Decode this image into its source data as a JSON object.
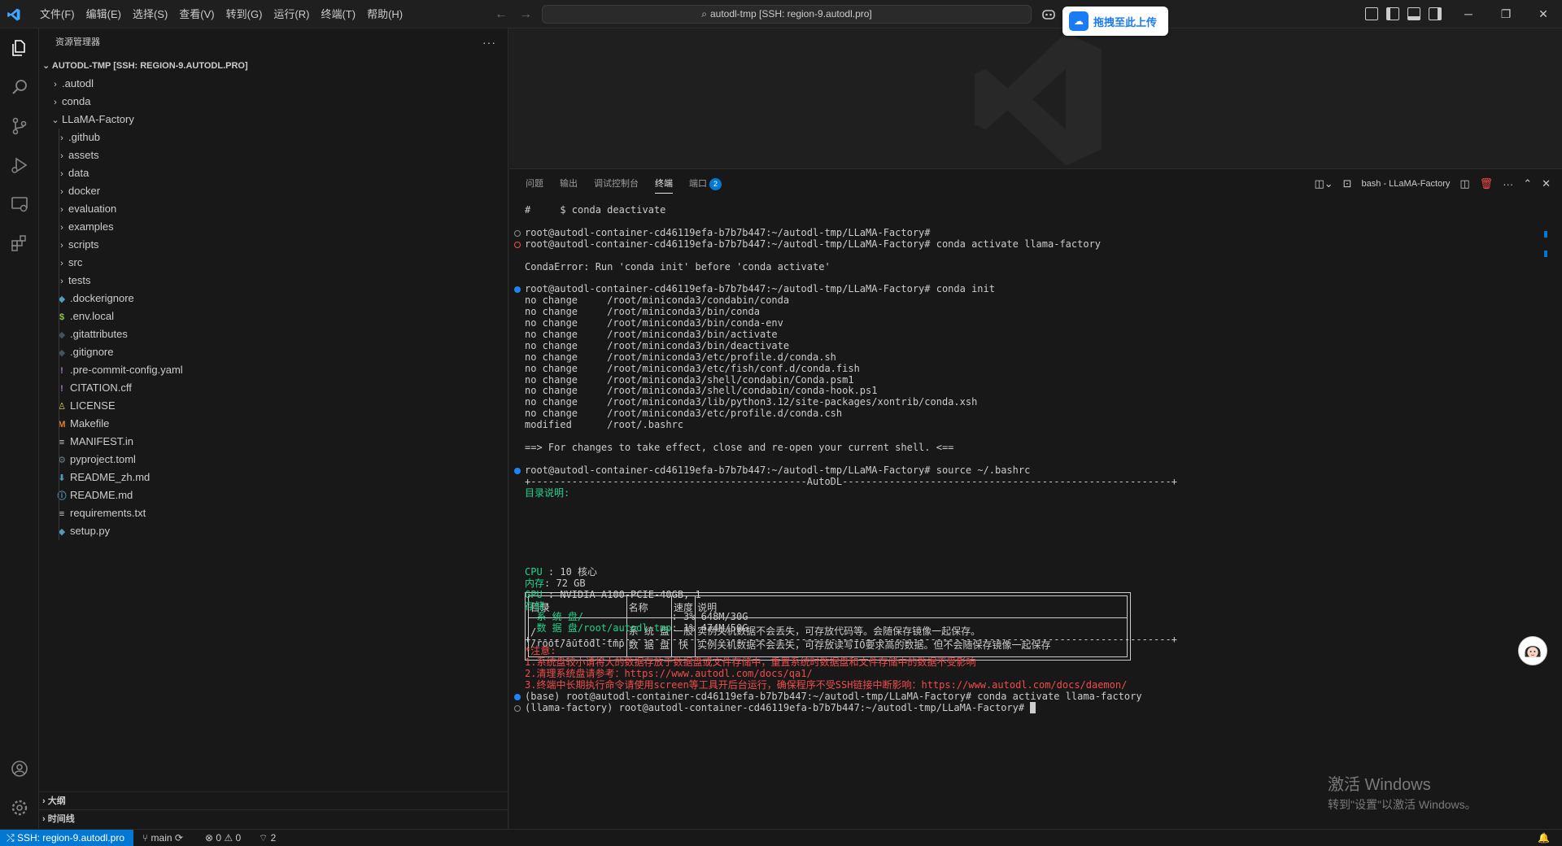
{
  "titlebar": {
    "menu": [
      "文件(F)",
      "编辑(E)",
      "选择(S)",
      "查看(V)",
      "转到(G)",
      "运行(R)",
      "终端(T)",
      "帮助(H)"
    ],
    "search": "autodl-tmp [SSH: region-9.autodl.pro]",
    "upload_label": "拖拽至此上传"
  },
  "sidebar": {
    "title": "资源管理器",
    "root": "AUTODL-TMP [SSH: REGION-9.AUTODL.PRO]",
    "items": [
      {
        "label": ".autodl",
        "type": "folder",
        "level": 0,
        "icon": "chevron-right"
      },
      {
        "label": "conda",
        "type": "folder",
        "level": 0,
        "icon": "chevron-right"
      },
      {
        "label": "LLaMA-Factory",
        "type": "folder",
        "level": 0,
        "icon": "chevron-down"
      },
      {
        "label": ".github",
        "type": "folder",
        "level": 1,
        "icon": "chevron-right"
      },
      {
        "label": "assets",
        "type": "folder",
        "level": 1,
        "icon": "chevron-right"
      },
      {
        "label": "data",
        "type": "folder",
        "level": 1,
        "icon": "chevron-right"
      },
      {
        "label": "docker",
        "type": "folder",
        "level": 1,
        "icon": "chevron-right"
      },
      {
        "label": "evaluation",
        "type": "folder",
        "level": 1,
        "icon": "chevron-right"
      },
      {
        "label": "examples",
        "type": "folder",
        "level": 1,
        "icon": "chevron-right"
      },
      {
        "label": "scripts",
        "type": "folder",
        "level": 1,
        "icon": "chevron-right"
      },
      {
        "label": "src",
        "type": "folder",
        "level": 1,
        "icon": "chevron-right"
      },
      {
        "label": "tests",
        "type": "folder",
        "level": 1,
        "icon": "chevron-right"
      },
      {
        "label": ".dockerignore",
        "type": "file",
        "level": 1,
        "glyph": "◆",
        "color": "#519aba"
      },
      {
        "label": ".env.local",
        "type": "file",
        "level": 1,
        "glyph": "$",
        "color": "#8dc149"
      },
      {
        "label": ".gitattributes",
        "type": "file",
        "level": 1,
        "glyph": "◆",
        "color": "#41535b"
      },
      {
        "label": ".gitignore",
        "type": "file",
        "level": 1,
        "glyph": "◆",
        "color": "#41535b"
      },
      {
        "label": ".pre-commit-config.yaml",
        "type": "file",
        "level": 1,
        "glyph": "!",
        "color": "#a074c4"
      },
      {
        "label": "CITATION.cff",
        "type": "file",
        "level": 1,
        "glyph": "!",
        "color": "#a074c4"
      },
      {
        "label": "LICENSE",
        "type": "file",
        "level": 1,
        "glyph": "♙",
        "color": "#cbcb41"
      },
      {
        "label": "Makefile",
        "type": "file",
        "level": 1,
        "glyph": "M",
        "color": "#e37933"
      },
      {
        "label": "MANIFEST.in",
        "type": "file",
        "level": 1,
        "glyph": "≡",
        "color": "#cccccc"
      },
      {
        "label": "pyproject.toml",
        "type": "file",
        "level": 1,
        "glyph": "⚙",
        "color": "#6d8086"
      },
      {
        "label": "README_zh.md",
        "type": "file",
        "level": 1,
        "glyph": "⬇",
        "color": "#519aba"
      },
      {
        "label": "README.md",
        "type": "file",
        "level": 1,
        "glyph": "ⓘ",
        "color": "#519aba"
      },
      {
        "label": "requirements.txt",
        "type": "file",
        "level": 1,
        "glyph": "≡",
        "color": "#cccccc"
      },
      {
        "label": "setup.py",
        "type": "file",
        "level": 1,
        "glyph": "◆",
        "color": "#519aba"
      }
    ],
    "outline": "大纲",
    "timeline": "时间线"
  },
  "panel": {
    "tabs": [
      "问题",
      "输出",
      "调试控制台",
      "终端",
      "端口"
    ],
    "active_tab": "终端",
    "ports_badge": "2",
    "terminal_name": "bash - LLaMA-Factory"
  },
  "terminal": {
    "lines": [
      {
        "text": "#     $ conda deactivate",
        "row": 0
      },
      {
        "text": "root@autodl-container-cd46119efa-b7b7b447:~/autodl-tmp/LLaMA-Factory#",
        "row": 2,
        "dot": "gray"
      },
      {
        "text": "root@autodl-container-cd46119efa-b7b7b447:~/autodl-tmp/LLaMA-Factory# conda activate llama-factory",
        "row": 3,
        "dot": "red"
      },
      {
        "text": "CondaError: Run 'conda init' before 'conda activate'",
        "row": 5
      },
      {
        "text": "root@autodl-container-cd46119efa-b7b7b447:~/autodl-tmp/LLaMA-Factory# conda init",
        "row": 7,
        "dot": "blue"
      },
      {
        "text": "no change     /root/miniconda3/condabin/conda",
        "row": 8
      },
      {
        "text": "no change     /root/miniconda3/bin/conda",
        "row": 9
      },
      {
        "text": "no change     /root/miniconda3/bin/conda-env",
        "row": 10
      },
      {
        "text": "no change     /root/miniconda3/bin/activate",
        "row": 11
      },
      {
        "text": "no change     /root/miniconda3/bin/deactivate",
        "row": 12
      },
      {
        "text": "no change     /root/miniconda3/etc/profile.d/conda.sh",
        "row": 13
      },
      {
        "text": "no change     /root/miniconda3/etc/fish/conf.d/conda.fish",
        "row": 14
      },
      {
        "text": "no change     /root/miniconda3/shell/condabin/Conda.psm1",
        "row": 15
      },
      {
        "text": "no change     /root/miniconda3/shell/condabin/conda-hook.ps1",
        "row": 16
      },
      {
        "text": "no change     /root/miniconda3/lib/python3.12/site-packages/xontrib/conda.xsh",
        "row": 17
      },
      {
        "text": "no change     /root/miniconda3/etc/profile.d/conda.csh",
        "row": 18
      },
      {
        "text": "modified      /root/.bashrc",
        "row": 19
      },
      {
        "text": "==> For changes to take effect, close and re-open your current shell. <==",
        "row": 21
      },
      {
        "text": "root@autodl-container-cd46119efa-b7b7b447:~/autodl-tmp/LLaMA-Factory# source ~/.bashrc",
        "row": 23,
        "dot": "blue"
      },
      {
        "text": "+-----------------------------------------------AutoDL--------------------------------------------------------+",
        "row": 24
      },
      {
        "text": "目录说明:",
        "row": 25,
        "color": "green"
      }
    ],
    "table": {
      "headers": [
        "目录",
        "名称",
        "速度",
        "说明"
      ],
      "row1": [
        "/",
        "系 统 盘",
        "一般",
        "实例关机数据不会丢失，可存放代码等。会随保存镜像一起保存。"
      ],
      "row2": [
        "/root/autodl-tmp",
        "数 据 盘",
        "快",
        "实例关机数据不会丢失，可存放读写IO要求高的数据。但不会随保存镜像一起保存"
      ]
    },
    "info": [
      {
        "label": "CPU",
        "value": " : 10 核心"
      },
      {
        "label": "内存",
        "value": ": 72 GB"
      },
      {
        "label": "GPU",
        "value": " : NVIDIA A100-PCIE-40GB, 1"
      },
      {
        "label": "存储",
        "value": ":"
      },
      {
        "label": "  系 统 盘/",
        "value": "               : 3% 648M/30G"
      },
      {
        "label": "  数 据 盘/root/autodl-tmp",
        "value": ": 1% 474M/50G"
      }
    ],
    "sep2": "+-------------------------------------------------------------------------------------------------------------+",
    "notes": [
      "*注意:",
      "1.系统盘较小请将大的数据存放于数据盘或文件存储中，重置系统时数据盘和文件存储中的数据不受影响",
      "2.清理系统盘请参考：https://www.autodl.com/docs/qa1/",
      "3.终端中长期执行命令请使用screen等工具开后台运行，确保程序不受SSH链接中断影响：https://www.autodl.com/docs/daemon/"
    ],
    "base_line": "(base) root@autodl-container-cd46119efa-b7b7b447:~/autodl-tmp/LLaMA-Factory# conda activate llama-factory",
    "env_prefix": "(llama-factory)",
    "final_prompt": " root@autodl-container-cd46119efa-b7b7b447:~/autodl-tmp/LLaMA-Factory# "
  },
  "watermark": {
    "title": "激活 Windows",
    "subtitle": "转到\"设置\"以激活 Windows。"
  },
  "statusbar": {
    "remote": "SSH: region-9.autodl.pro",
    "branch": "main",
    "problems": "⊗ 0 ⚠ 0",
    "ports": "2"
  },
  "colors": {
    "accent": "#0078d4",
    "terminal_green": "#23d18b",
    "terminal_red": "#f14c4c",
    "highlight": "#1e90ff"
  }
}
